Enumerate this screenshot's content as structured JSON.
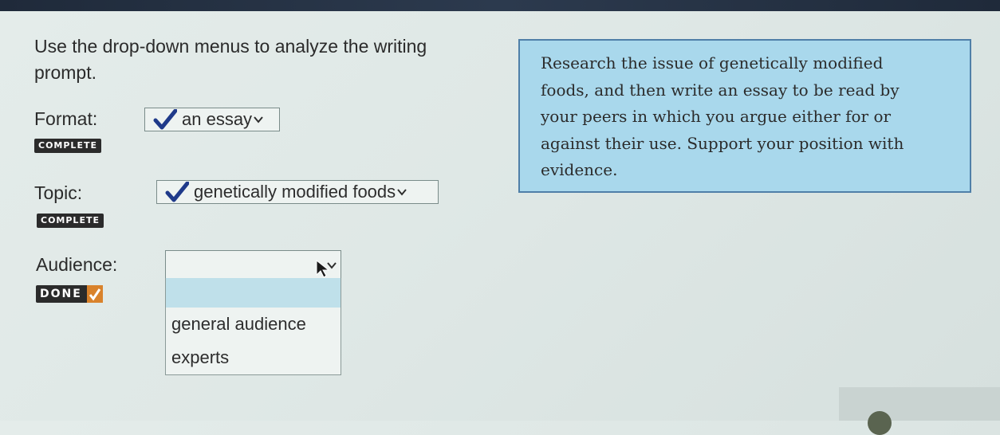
{
  "instructions": {
    "line1": "Use the drop-down menus to analyze the writing",
    "line2": "prompt."
  },
  "format": {
    "label": "Format:",
    "selected": "an essay",
    "status": "COMPLETE"
  },
  "topic": {
    "label": "Topic:",
    "selected": "genetically modified foods",
    "status": "COMPLETE"
  },
  "audience": {
    "label": "Audience:",
    "selected": "",
    "status": "DONE",
    "options": [
      "general audience",
      "experts"
    ]
  },
  "prompt": {
    "line1": "Research the issue of genetically modified",
    "line2": "foods, and then write an essay to be read by",
    "line3": "your peers in which you argue either for or",
    "line4": "against their use. Support your position with",
    "line5": "evidence."
  },
  "colors": {
    "prompt_background": "#a9d8ec",
    "prompt_border": "#4f7fa8",
    "badge_background": "#2b2b2b",
    "done_check": "#d9822b",
    "check_icon": "#1f3a8a"
  },
  "icons": {
    "check": "check-mark-icon",
    "caret": "chevron-down-icon",
    "cursor": "mouse-pointer-icon"
  }
}
